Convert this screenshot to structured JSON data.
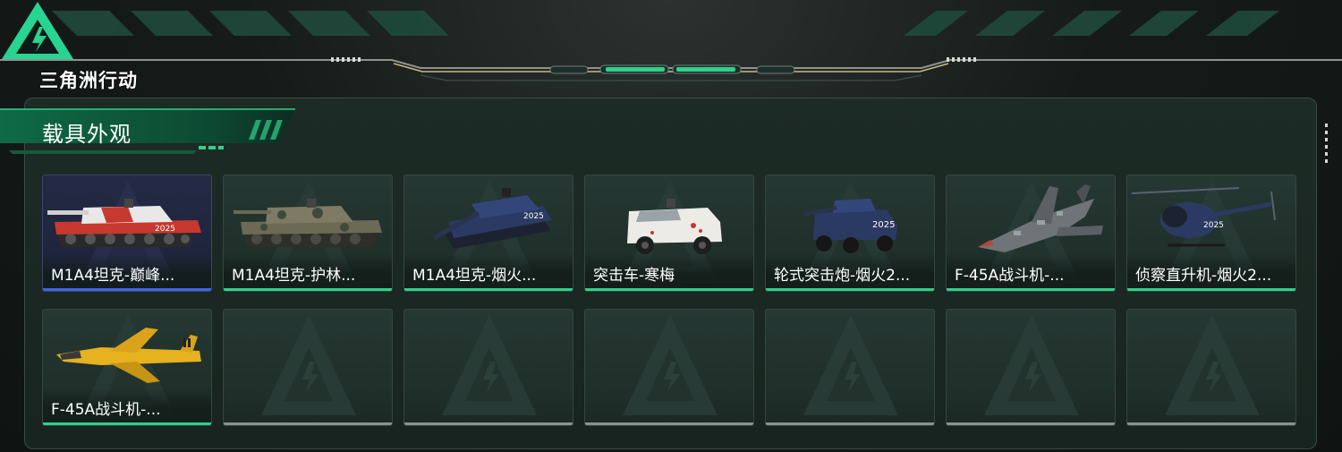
{
  "header": {
    "logo_text": "三角洲行动",
    "accent_color": "#2fd08b"
  },
  "section": {
    "title": "载具外观"
  },
  "items": [
    {
      "label": "M1A4坦克-巅峰...",
      "icon": "tank-icon",
      "state": "selected",
      "rarity_color": "#3e66e0"
    },
    {
      "label": "M1A4坦克-护林...",
      "icon": "tank-icon",
      "state": "owned",
      "rarity_color": "#2fd08b"
    },
    {
      "label": "M1A4坦克-烟火...",
      "icon": "tank-icon",
      "state": "owned",
      "rarity_color": "#2fd08b"
    },
    {
      "label": "突击车-寒梅",
      "icon": "armored-car-icon",
      "state": "owned",
      "rarity_color": "#2fd08b"
    },
    {
      "label": "轮式突击炮-烟火2...",
      "icon": "wheeled-assault-gun-icon",
      "state": "owned",
      "rarity_color": "#2fd08b"
    },
    {
      "label": "F-45A战斗机-...",
      "icon": "fighter-jet-icon",
      "state": "owned",
      "rarity_color": "#2fd08b"
    },
    {
      "label": "侦察直升机-烟火2...",
      "icon": "helicopter-icon",
      "state": "owned",
      "rarity_color": "#2fd08b"
    },
    {
      "label": "F-45A战斗机-...",
      "icon": "fighter-jet-icon",
      "state": "owned",
      "rarity_color": "#2fd08b"
    }
  ],
  "empty_slot_icon": "delta-logo-icon"
}
